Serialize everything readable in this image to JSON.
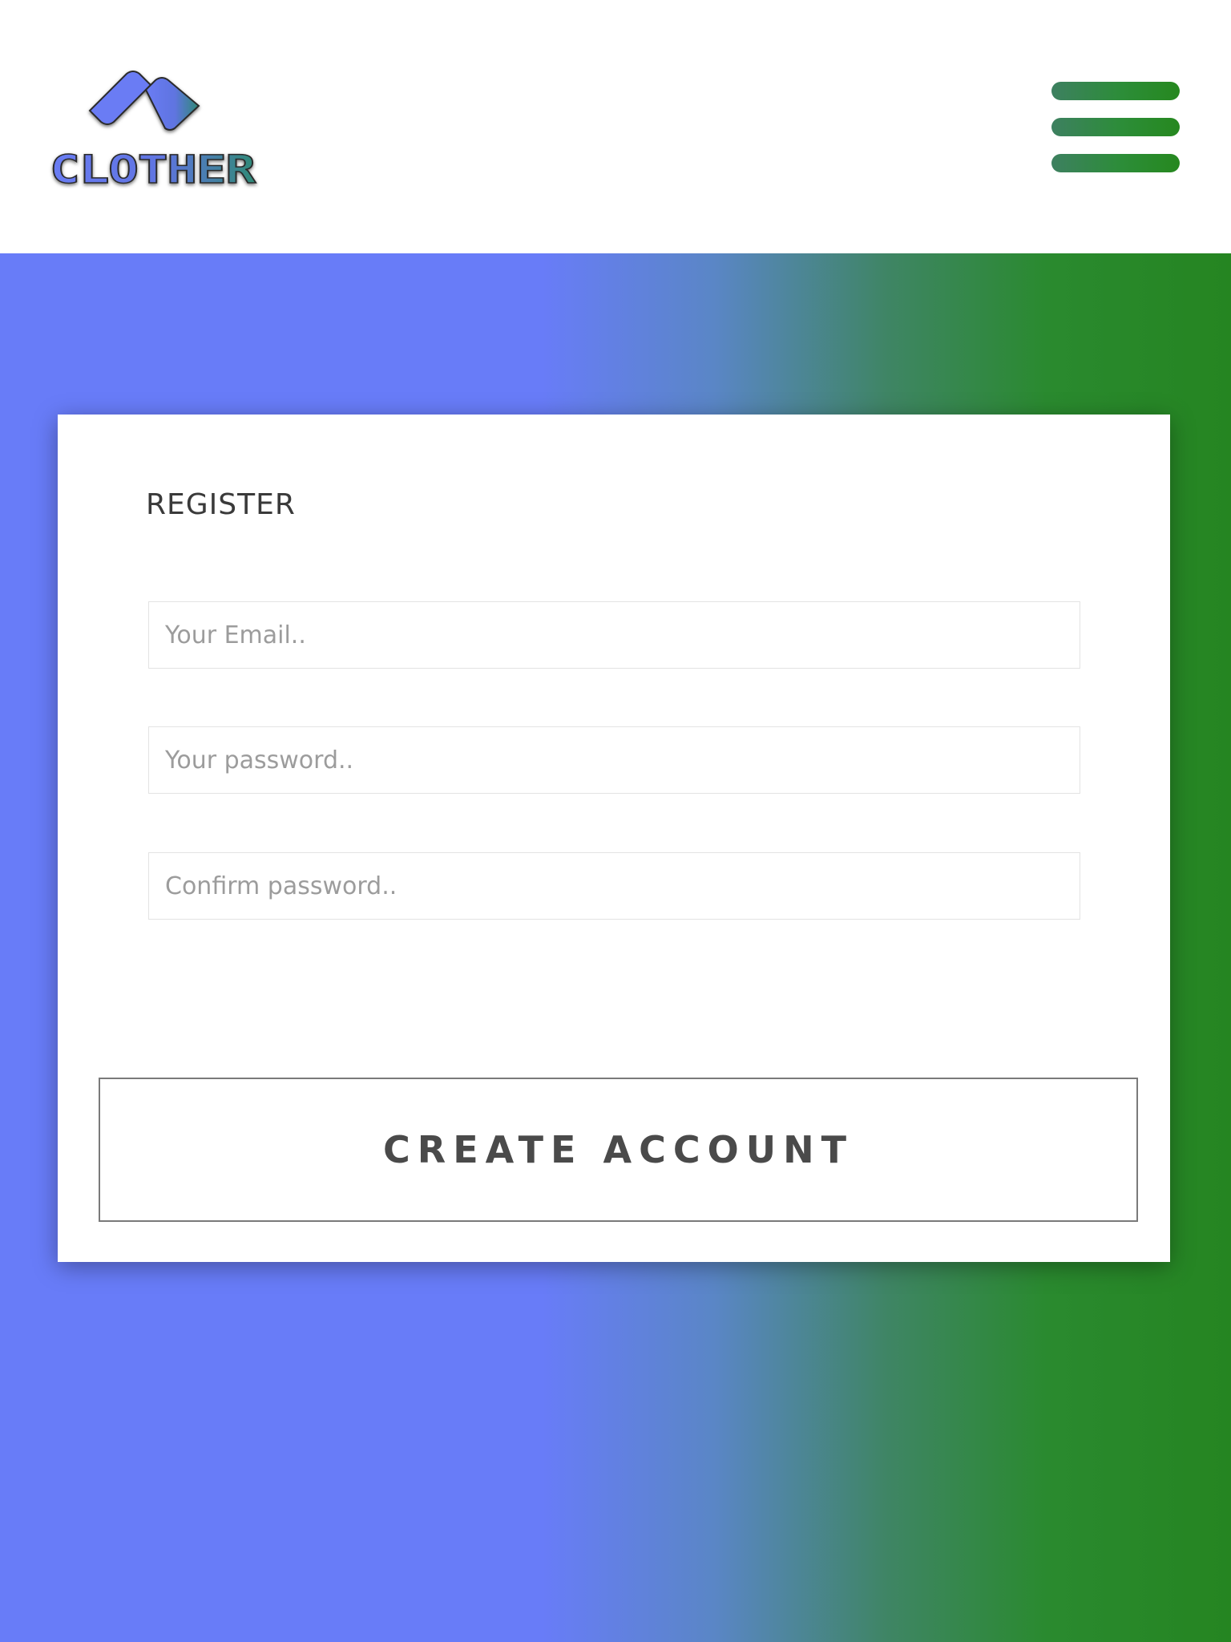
{
  "header": {
    "logo_text": "CLOTHER",
    "menu_icon": "hamburger-menu-icon"
  },
  "register": {
    "title": "REGISTER",
    "email_placeholder": "Your Email..",
    "password_placeholder": "Your password..",
    "confirm_placeholder": "Confirm password..",
    "submit_label": "CREATE ACCOUNT"
  },
  "colors": {
    "gradient_start": "#687cf8",
    "gradient_end": "#258521",
    "menu_bar": "#2c8d38",
    "card_background": "#ffffff",
    "title_text": "#3a3a3a",
    "placeholder_text": "#9c9c9c",
    "button_border": "#7a7a7a"
  }
}
